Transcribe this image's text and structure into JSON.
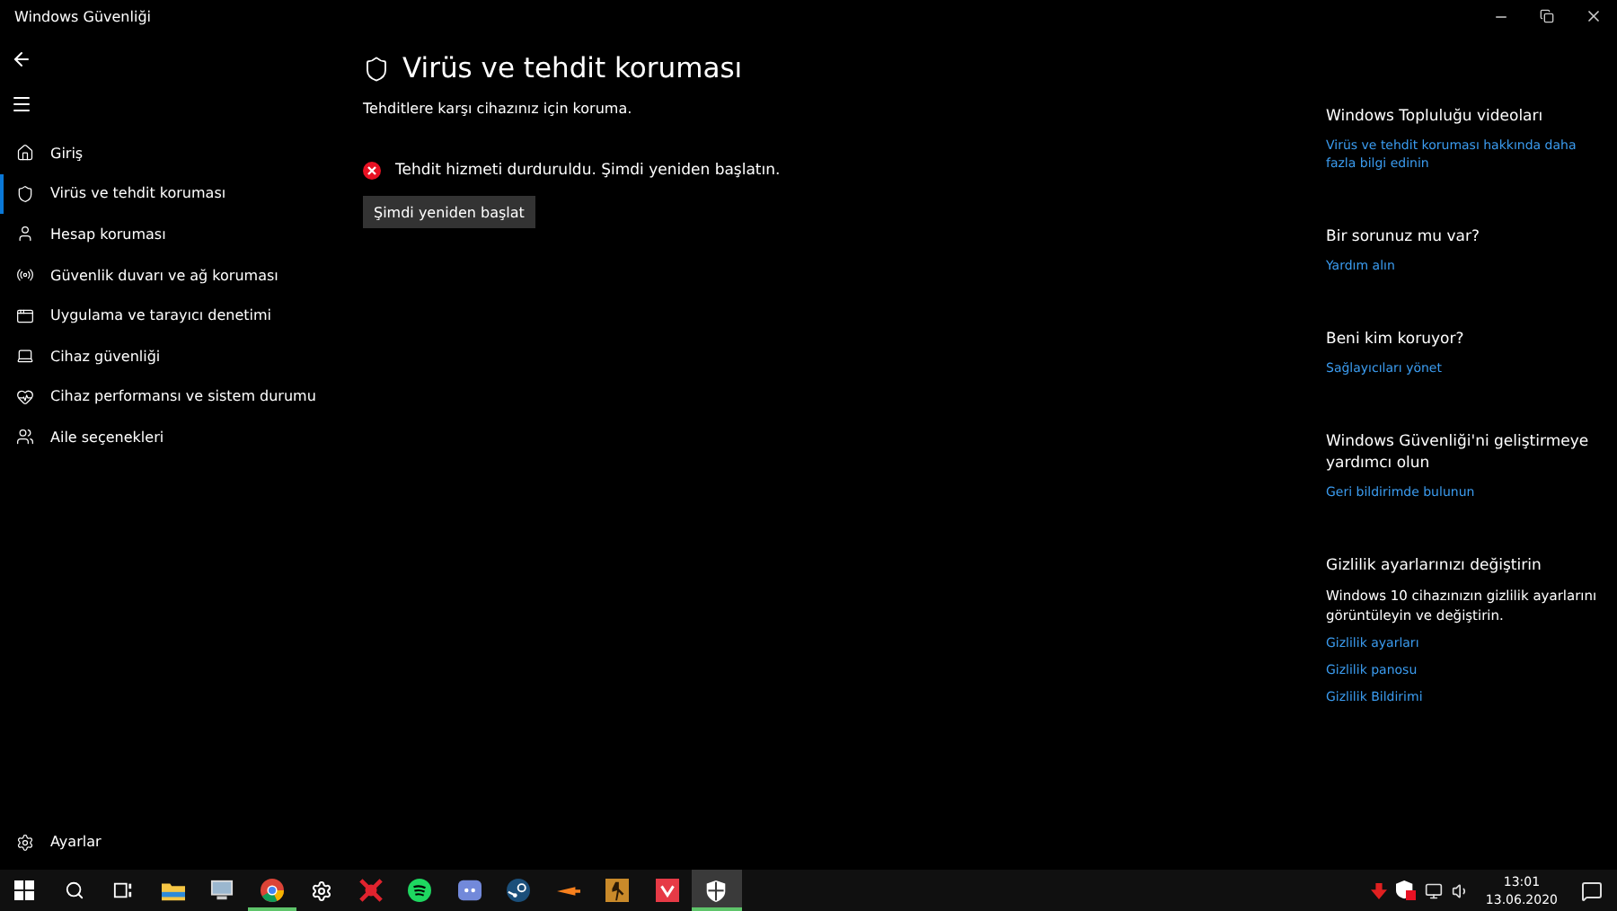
{
  "window": {
    "title": "Windows Güvenliği"
  },
  "sidebar": {
    "items": [
      {
        "label": "Giriş",
        "selected": false
      },
      {
        "label": "Virüs ve tehdit koruması",
        "selected": true
      },
      {
        "label": "Hesap koruması",
        "selected": false
      },
      {
        "label": "Güvenlik duvarı ve ağ koruması",
        "selected": false
      },
      {
        "label": "Uygulama ve tarayıcı denetimi",
        "selected": false
      },
      {
        "label": "Cihaz güvenliği",
        "selected": false
      },
      {
        "label": "Cihaz performansı ve sistem durumu",
        "selected": false
      },
      {
        "label": "Aile seçenekleri",
        "selected": false
      }
    ],
    "settings": "Ayarlar"
  },
  "main": {
    "title": "Virüs ve tehdit koruması",
    "subtitle": "Tehditlere karşı cihazınız için koruma.",
    "alert": "Tehdit hizmeti durduruldu. Şimdi yeniden başlatın.",
    "button": "Şimdi yeniden başlat"
  },
  "side_panel": [
    {
      "heading": "Windows Topluluğu videoları",
      "links": [
        "Virüs ve tehdit koruması hakkında daha fazla bilgi edinin"
      ]
    },
    {
      "heading": "Bir sorunuz mu var?",
      "links": [
        "Yardım alın"
      ]
    },
    {
      "heading": "Beni kim koruyor?",
      "links": [
        "Sağlayıcıları yönet"
      ]
    },
    {
      "heading": "Windows Güvenliği'ni geliştirmeye yardımcı olun",
      "links": [
        "Geri bildirimde bulunun"
      ]
    },
    {
      "heading": "Gizlilik ayarlarınızı değiştirin",
      "text": "Windows 10 cihazınızın gizlilik ayarlarını görüntüleyin ve değiştirin.",
      "links": [
        "Gizlilik ayarları",
        "Gizlilik panosu",
        "Gizlilik Bildirimi"
      ]
    }
  ],
  "taskbar": {
    "apps": [
      {
        "kind": "start",
        "running": false,
        "selected": false
      },
      {
        "kind": "search",
        "running": false,
        "selected": false
      },
      {
        "kind": "taskview",
        "running": false,
        "selected": false
      },
      {
        "kind": "folder",
        "running": false,
        "selected": false
      },
      {
        "kind": "monitor",
        "running": false,
        "selected": false
      },
      {
        "kind": "browser",
        "running": true,
        "selected": false
      },
      {
        "kind": "gear",
        "running": false,
        "selected": false
      },
      {
        "kind": "redstar",
        "running": false,
        "selected": false
      },
      {
        "kind": "music",
        "running": false,
        "selected": false
      },
      {
        "kind": "chat",
        "running": false,
        "selected": false
      },
      {
        "kind": "steam",
        "running": false,
        "selected": false
      },
      {
        "kind": "arrow",
        "running": false,
        "selected": false
      },
      {
        "kind": "game",
        "running": false,
        "selected": false
      },
      {
        "kind": "redapp",
        "running": false,
        "selected": false
      },
      {
        "kind": "shield",
        "running": true,
        "selected": true
      }
    ],
    "time": "13:01",
    "date": "13.06.2020"
  }
}
